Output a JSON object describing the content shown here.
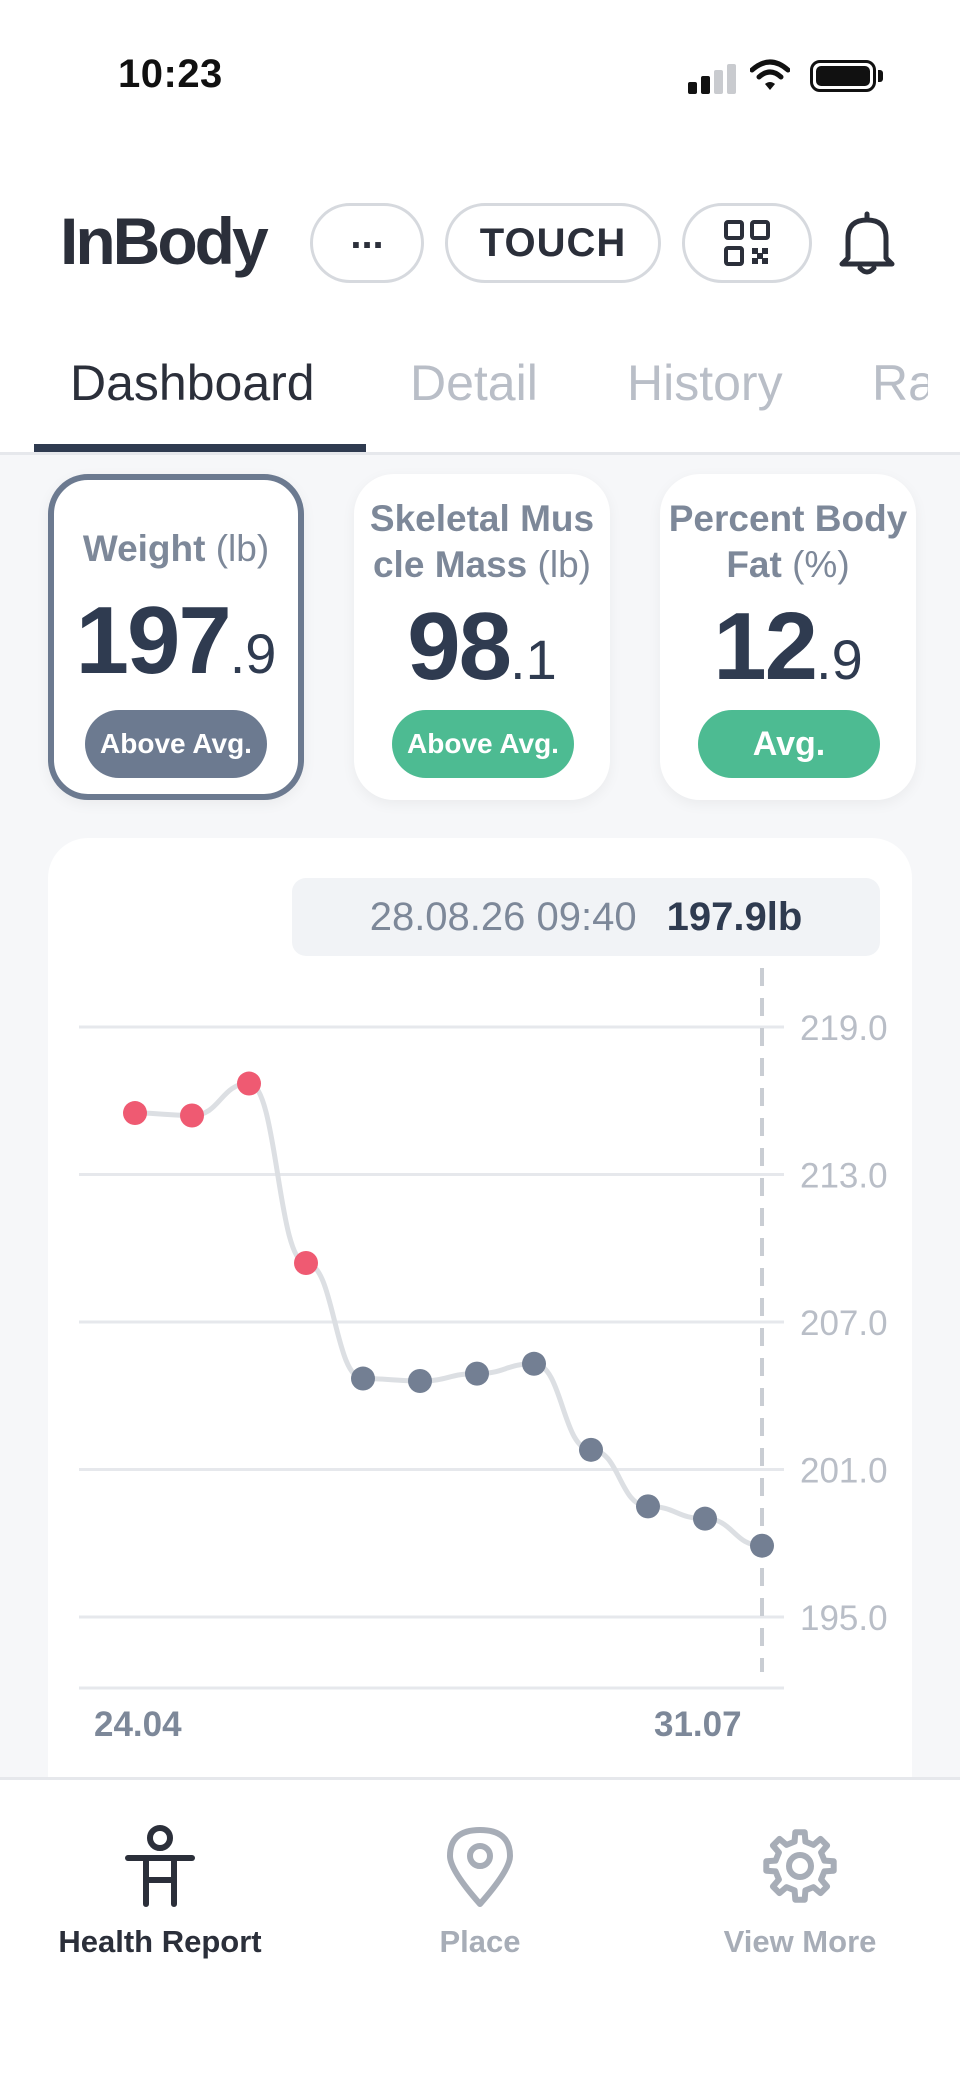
{
  "status_bar": {
    "time": "10:23"
  },
  "header": {
    "logo": "InBody",
    "more_label": "...",
    "touch_label": "TOUCH",
    "qr_icon": "qr-code-icon",
    "bell_icon": "bell-icon"
  },
  "tabs": [
    {
      "label": "Dashboard",
      "active": true
    },
    {
      "label": "Detail"
    },
    {
      "label": "History"
    },
    {
      "label": "Ra"
    }
  ],
  "metrics": [
    {
      "title": "Weight",
      "unit": "(lb)",
      "int": "197",
      "dec": ".9",
      "status": "Above Avg.",
      "status_color": "#6c7a90",
      "selected": true
    },
    {
      "title": "Skeletal Muscle Mass",
      "unit": "(lb)",
      "int": "98",
      "dec": ".1",
      "status": "Above Avg.",
      "status_color": "#4dbb92"
    },
    {
      "title": "Percent Body Fat",
      "unit": "(%)",
      "int": "12",
      "dec": ".9",
      "status": "Avg.",
      "status_color": "#4dbb92"
    }
  ],
  "chart_tooltip": {
    "date": "28.08.26 09:40",
    "value": "197.9lb"
  },
  "chart_data": {
    "type": "line",
    "series": [
      {
        "values": [
          215.5,
          215.4,
          216.7,
          209.4,
          204.7,
          204.6,
          204.9,
          205.3,
          201.8,
          199.5,
          199.0,
          197.9
        ],
        "status": [
          "above",
          "above",
          "above",
          "above",
          "avg",
          "avg",
          "avg",
          "avg",
          "avg",
          "avg",
          "avg",
          "avg"
        ]
      }
    ],
    "x_labels": [
      "24.04",
      "31.07"
    ],
    "y_ticks": [
      "219.0",
      "213.0",
      "207.0",
      "201.0",
      "195.0"
    ],
    "ylim": [
      195.0,
      219.0
    ],
    "selected_index": 11,
    "colors": {
      "above": "#ef5a72",
      "avg": "#737f93",
      "line": "#dcdfe3",
      "grid": "#e6e8ec",
      "cursor": "#c9cdd3"
    }
  },
  "bottom_nav": [
    {
      "label": "Health Report",
      "icon": "body-icon",
      "active": true
    },
    {
      "label": "Place",
      "icon": "location-pin-icon"
    },
    {
      "label": "View More",
      "icon": "gear-icon"
    }
  ]
}
